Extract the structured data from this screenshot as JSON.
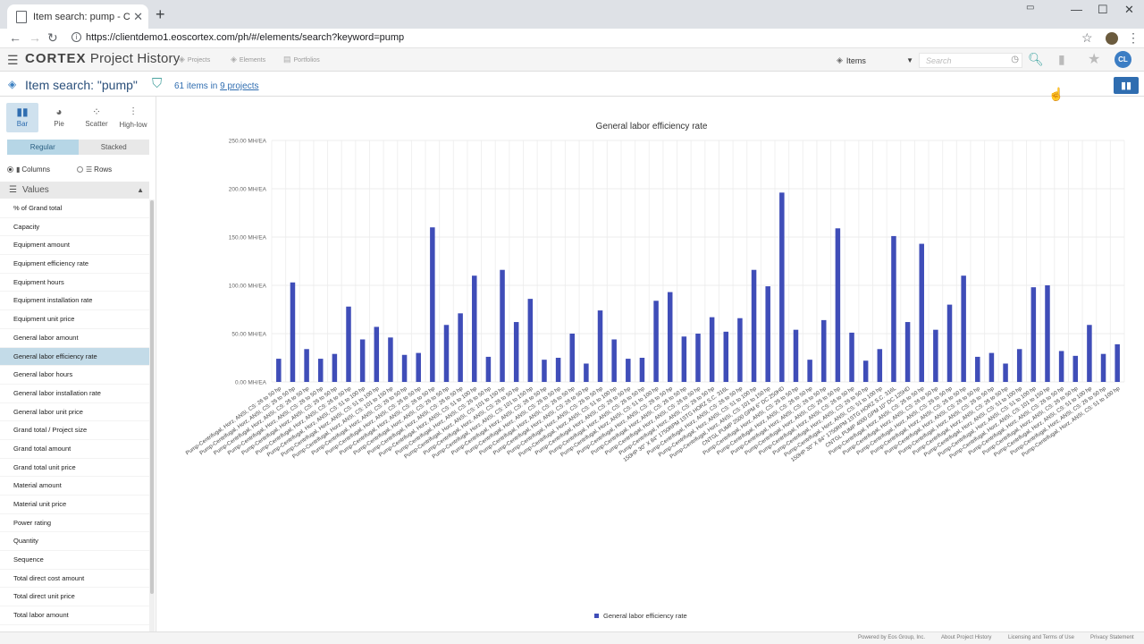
{
  "browser": {
    "tab_title": "Item search: pump - Cortex Proje",
    "url": "https://clientdemo1.eoscortex.com/ph/#/elements/search?keyword=pump"
  },
  "app": {
    "brand_bold": "CORTEX",
    "brand_rest": "Project History",
    "nav": [
      {
        "label": "Projects",
        "icon": "projects-icon"
      },
      {
        "label": "Elements",
        "icon": "elements-icon"
      },
      {
        "label": "Portfolios",
        "icon": "portfolios-icon"
      }
    ],
    "scope_label": "Items",
    "search_placeholder": "Search",
    "user_initials": "CL"
  },
  "page": {
    "title": "Item search: \"pump\"",
    "count_text": "61 items in",
    "projects_link": "9 projects"
  },
  "sidebar": {
    "chart_types": [
      "Bar",
      "Pie",
      "Scatter",
      "High-low"
    ],
    "modes": [
      "Regular",
      "Stacked"
    ],
    "orientation": [
      "Columns",
      "Rows"
    ],
    "values_header": "Values",
    "values": [
      "% of Grand total",
      "Capacity",
      "Equipment amount",
      "Equipment efficiency rate",
      "Equipment hours",
      "Equipment installation rate",
      "Equipment unit price",
      "General labor amount",
      "General labor efficiency rate",
      "General labor hours",
      "General labor installation rate",
      "General labor unit price",
      "Grand total / Project size",
      "Grand total amount",
      "Grand total unit price",
      "Material amount",
      "Material unit price",
      "Power rating",
      "Quantity",
      "Sequence",
      "Total direct cost amount",
      "Total direct unit price",
      "Total labor amount"
    ],
    "selected_value": "General labor efficiency rate"
  },
  "chart_data": {
    "type": "bar",
    "title": "General labor efficiency rate",
    "ylim": [
      0,
      250
    ],
    "yticks": [
      "0.00 MH/EA",
      "50.00 MH/EA",
      "100.00 MH/EA",
      "150.00 MH/EA",
      "200.00 MH/EA",
      "250.00 MH/EA"
    ],
    "legend": "General labor efficiency rate",
    "color": "#3f4db8",
    "categories": [
      "Pump-Centrifugal, Horz, ANSI, CS: 26 to 50 hp",
      "Pump-Centrifugal, Horz, ANSI, CS: 26 to 50 hp",
      "Pump-Centrifugal, Horz, ANSI, CS: 26 to 50 hp",
      "Pump-Centrifugal, Horz, ANSI, CS: 26 to 50 hp",
      "Pump-Centrifugal, Horz, ANSI, CS: 26 to 50 hp",
      "Pump-Centrifugal, Horz, ANSI, CS: 26 to 50 hp",
      "Pump-Centrifugal, Horz, ANSI, CS: 51 to 100 hp",
      "Pump-Centrifugal, Horz, ANSI, CS: 51 to 100 hp",
      "Pump-Centrifugal, Horz, ANSI, CS: 101 to 150 hp",
      "Pump-Centrifugal, Horz, ANSI, CS: 26 to 50 hp",
      "Pump-Centrifugal, Horz, ANSI, CS: 26 to 50 hp",
      "Pump-Centrifugal, Horz, ANSI, CS: 26 to 50 hp",
      "Pump-Centrifugal, Horz, ANSI, CS: 26 to 50 hp",
      "Pump-Centrifugal, Horz, ANSI, CS: 26 to 50 hp",
      "Pump-Centrifugal, Horz, ANSI, CS: 51 to 100 hp",
      "Pump-Centrifugal, Horz, ANSI, CS: 26 to 50 hp",
      "Pump-Centrifugal, Horz, ANSI, CS: 101 to 150 hp",
      "Pump-Centrifugal, Horz, ANSI, CS: 26 to 50 hp",
      "Pump-Centrifugal, Horz, ANSI, CS: 101 to 150 hp",
      "Pump-Centrifugal, Horz, ANSI, CS: 26 to 50 hp",
      "Pump-Centrifugal, Horz, ANSI, CS: 26 to 50 hp",
      "Pump-Centrifugal, Horz, ANSI, CS: 26 to 50 hp",
      "Pump-Centrifugal, Horz, ANSI, CS: 26 to 50 hp",
      "Pump-Centrifugal, Horz, ANSI, CS: 26 to 50 hp",
      "Pump-Centrifugal, Horz, ANSI, CS: 51 to 100 hp",
      "Pump-Centrifugal, Horz, ANSI, CS: 26 to 50 hp",
      "Pump-Centrifugal, Horz, ANSI, CS: 26 to 50 hp",
      "Pump-Centrifugal, Horz, ANSI, CS: 51 to 100 hp",
      "Pump-Centrifugal, Horz, ANSI, CS: 26 to 50 hp",
      "Pump-Centrifugal, Horz, ANSI, CS: 26 to 50 hp",
      "Pump-Centrifugal, Horz, ANSI, CS: 26 to 50 hp",
      "Pump-Centrifugal, Horz, ANSI, CS: 26 to 50 hp",
      "150HP 30\" X 84\" 1750RPM 1STG HORZ S.C. 316L",
      "Pump-Centrifugal, Horz, ANSI, CS: 26 to 50 hp",
      "Pump-Centrifugal, Horz, ANSI, CS: 51 to 100 hp",
      "Pump-Centrifugal, Horz, ANSI, CS: 101 to 150 hp",
      "CNTGL PUMP 2500 GPM 6\" DC 250HD",
      "Pump-Centrifugal, Horz, ANSI, CS: 26 to 50 hp",
      "Pump-Centrifugal, Horz, ANSI, CS: 26 to 50 hp",
      "Pump-Centrifugal, Horz, ANSI, CS: 26 to 50 hp",
      "Pump-Centrifugal, Horz, ANSI, CS: 26 to 50 hp",
      "Pump-Centrifugal, Horz, ANSI, CS: 26 to 50 hp",
      "Pump-Centrifugal, Horz, ANSI, CS: 26 to 50 hp",
      "Pump-Centrifugal, Horz, ANSI, CS: 51 to 100 hp",
      "150HP 30\" X 84\" 1750RPM 1STG HORZ S.C. 316L",
      "CNTGL PUMP 4000 GPM 10\" DC 125HD",
      "Pump-Centrifugal, Horz, ANSI, CS: 26 to 50 hp",
      "Pump-Centrifugal, Horz, ANSI, CS: 26 to 50 hp",
      "Pump-Centrifugal, Horz, ANSI, CS: 26 to 50 hp",
      "Pump-Centrifugal, Horz, ANSI, CS: 26 to 50 hp",
      "Pump-Centrifugal, Horz, ANSI, CS: 26 to 50 hp",
      "Pump-Centrifugal, Horz, ANSI, CS: 26 to 50 hp",
      "Pump-Centrifugal, Horz, ANSI, CS: 26 to 50 hp",
      "Pump-Centrifugal, Horz, ANSI, CS: 51 to 100 hp",
      "Pump-Centrifugal, Horz, ANSI, CS: 51 to 100 hp",
      "Pump-Centrifugal, Horz, ANSI, CS: 101 to 150 hp",
      "Pump-Centrifugal, Horz, ANSI, CS: 26 to 50 hp",
      "Pump-Centrifugal, Horz, ANSI, CS: 26 to 50 hp",
      "Pump-Centrifugal, Horz, ANSI, CS: 51 to 100 hp",
      "Pump-Centrifugal, Horz, ANSI, CS: 26 to 50 hp",
      "Pump-Centrifugal, Horz, ANSI, CS: 51 to 100 hp"
    ],
    "values": [
      24,
      103,
      34,
      24,
      29,
      78,
      44,
      57,
      46,
      28,
      30,
      160,
      59,
      71,
      110,
      26,
      116,
      62,
      86,
      23,
      25,
      50,
      19,
      74,
      44,
      24,
      25,
      84,
      93,
      47,
      50,
      67,
      52,
      66,
      116,
      99,
      196,
      54,
      23,
      64,
      159,
      51,
      22,
      34,
      151,
      62,
      143,
      54,
      80,
      110,
      26,
      30,
      19,
      34,
      98,
      100,
      32,
      27,
      59,
      29,
      39
    ]
  },
  "footer": {
    "powered": "Powered by Eos Group, Inc.",
    "about": "About Project History",
    "licensing": "Licensing and Terms of Use",
    "privacy": "Privacy Statement"
  }
}
